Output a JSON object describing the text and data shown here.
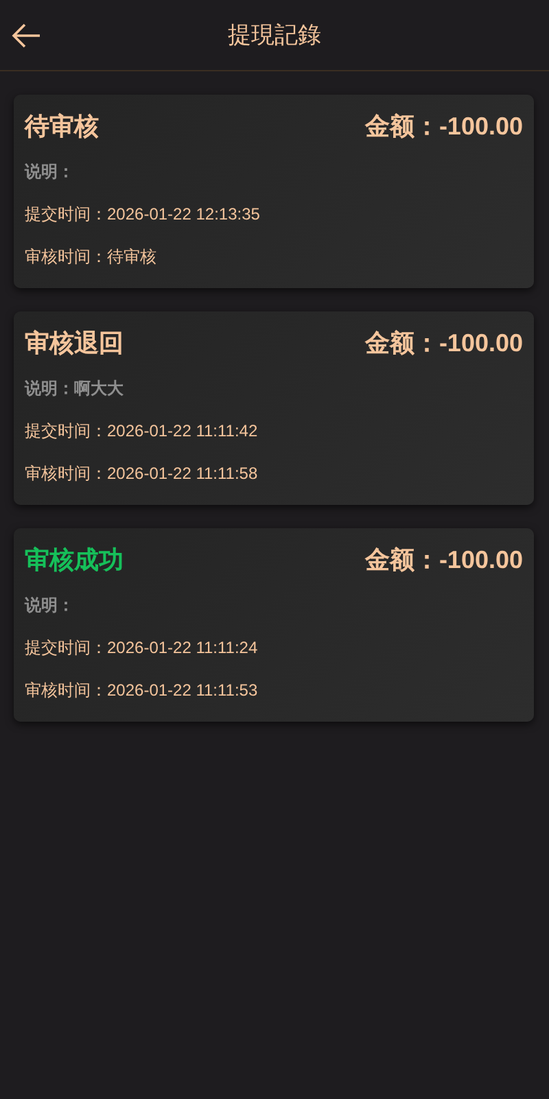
{
  "header": {
    "title": "提現記錄"
  },
  "records": [
    {
      "status": "待审核",
      "color": "#f5c59c",
      "amount": "金额：-100.00",
      "note": "说明：",
      "submitted": "提交时间：2026-01-22 12:13:35",
      "reviewed": "审核时间：待审核"
    },
    {
      "status": "审核退回",
      "color": "#f5c59c",
      "amount": "金额：-100.00",
      "note": "说明：啊大大",
      "submitted": "提交时间：2026-01-22 11:11:42",
      "reviewed": "审核时间：2026-01-22 11:11:58"
    },
    {
      "status": "审核成功",
      "color": "#16c05a",
      "amount": "金额：-100.00",
      "note": "说明：",
      "submitted": "提交时间：2026-01-22 11:11:24",
      "reviewed": "审核时间：2026-01-22 11:11:53"
    }
  ]
}
